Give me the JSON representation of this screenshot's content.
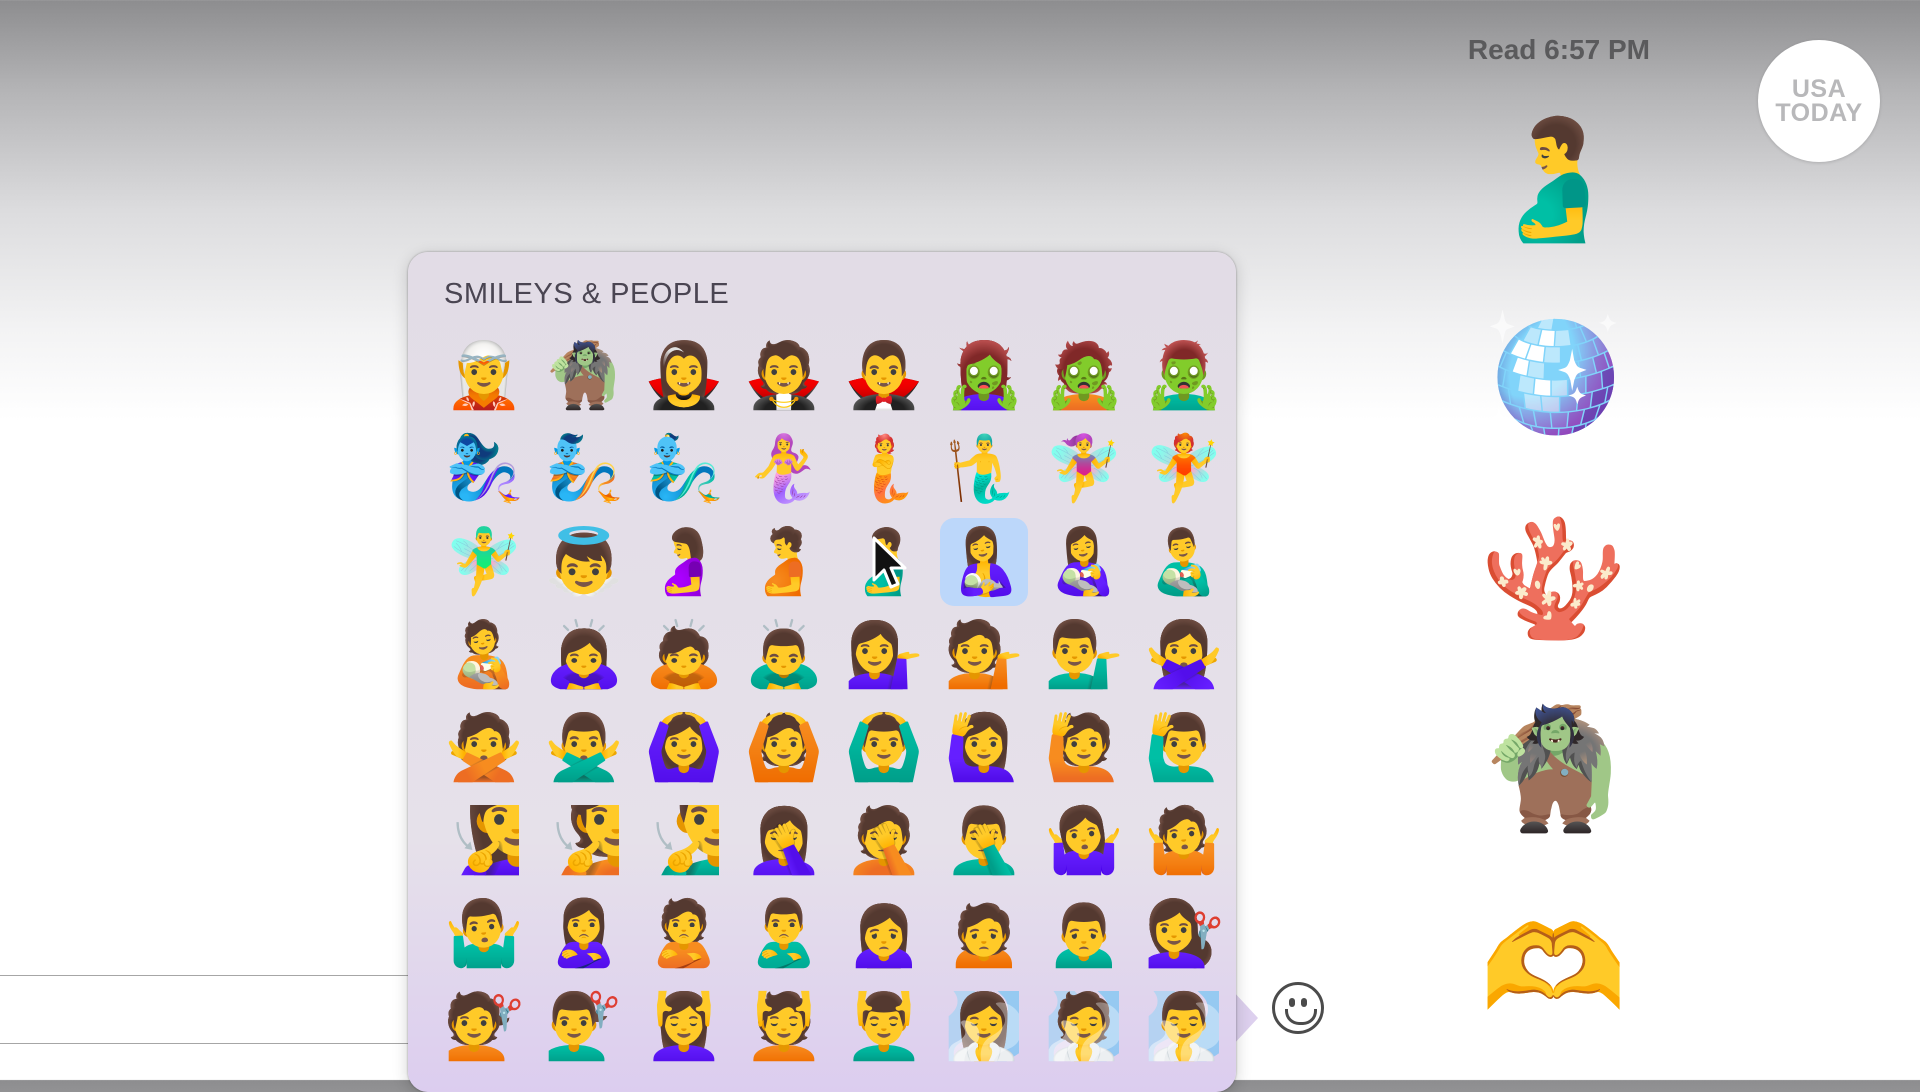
{
  "conversation": {
    "read_receipt": "Read 6:57 PM",
    "watermark_text": "USA TODAY",
    "sent_emojis": [
      "🫃",
      "🪩",
      "🪸",
      "🧌",
      "🫶"
    ]
  },
  "message_field": {
    "value": ""
  },
  "emoji_picker": {
    "section_title": "SMILEYS & PEOPLE",
    "selected_index": 21,
    "emojis": [
      "🧝",
      "🧌",
      "🧛‍♀️",
      "🧛",
      "🧛‍♂️",
      "🧟‍♀️",
      "🧟",
      "🧟‍♂️",
      "🧞‍♀️",
      "🧞",
      "🧞‍♂️",
      "🧜‍♀️",
      "🧜",
      "🧜‍♂️",
      "🧚‍♀️",
      "🧚",
      "🧚‍♂️",
      "👼",
      "🤰",
      "🫄",
      "🫃",
      "🤱",
      "👩‍🍼",
      "👨‍🍼",
      "🧑‍🍼",
      "🙇‍♀️",
      "🙇",
      "🙇‍♂️",
      "💁‍♀️",
      "💁",
      "💁‍♂️",
      "🙅‍♀️",
      "🙅",
      "🙅‍♂️",
      "🙆‍♀️",
      "🙆",
      "🙆‍♂️",
      "🙋‍♀️",
      "🙋",
      "🙋‍♂️",
      "🧏‍♀️",
      "🧏",
      "🧏‍♂️",
      "🤦‍♀️",
      "🤦",
      "🤦‍♂️",
      "🤷‍♀️",
      "🤷",
      "🤷‍♂️",
      "🙎‍♀️",
      "🙎",
      "🙎‍♂️",
      "🙍‍♀️",
      "🙍",
      "🙍‍♂️",
      "💇‍♀️",
      "💇",
      "💇‍♂️",
      "💆‍♀️",
      "💆",
      "💆‍♂️",
      "🧖‍♀️",
      "🧖",
      "🧖‍♂️"
    ]
  },
  "icons": {
    "emoji_button": "smiley-face-icon",
    "pointer": "mouse-cursor-icon"
  }
}
